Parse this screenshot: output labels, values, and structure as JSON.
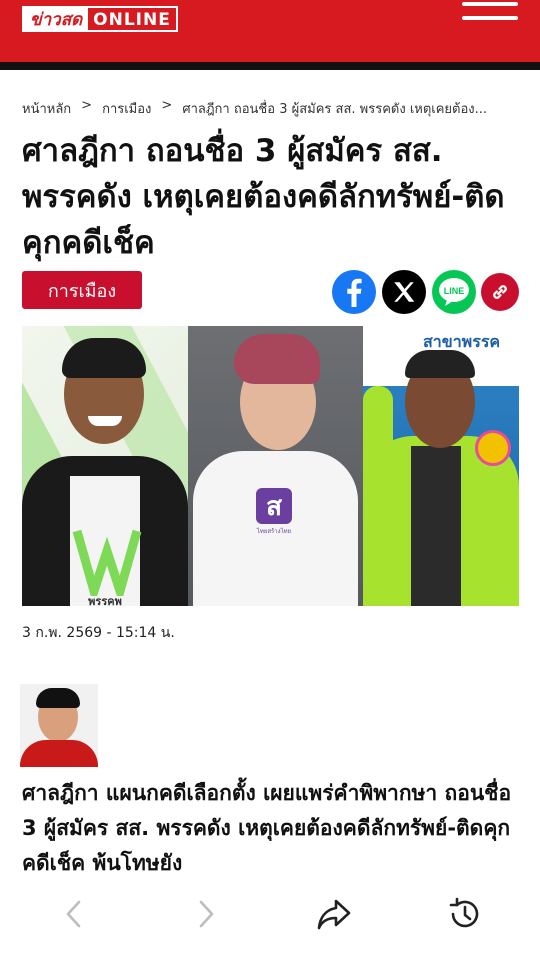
{
  "header": {
    "logo_thai": "ข่าวสด",
    "logo_online": "ONLINE",
    "menu_icon": "hamburger-menu-icon",
    "brand_color": "#d71920"
  },
  "breadcrumb": {
    "home": "หน้าหลัก",
    "section": "การเมือง",
    "current": "ศาลฎีกา ถอนชื่อ 3 ผู้สมัคร สส. พรรคดัง เหตุเคยต้อง...",
    "separator": ">"
  },
  "article": {
    "title": "ศาลฎีกา ถอนชื่อ 3 ผู้สมัคร สส. พรรคดัง เหตุเคยต้องคดีลักทรัพย์-ติดคุกคดีเช็ค",
    "category": "การเมือง",
    "date": "3 ก.พ. 2569 - 15:14 น.",
    "lead": "ศาลฎีกา แผนกคดีเลือกตั้ง เผยแพร่คำพิพากษา ถอนชื่อ 3 ผู้สมัคร สส. พรรคดัง เหตุเคยต้องคดีลักทรัพย์-ติดคุกคดีเช็ค พ้นโทษยัง"
  },
  "share": {
    "facebook": "facebook-icon",
    "x": "x-icon",
    "line": "line-icon",
    "line_text": "LINE",
    "copy_link": "link-icon"
  },
  "photos": {
    "panel1_shirt_text": "พรรคพ",
    "panel2_badge": "ส",
    "panel2_badge_sub": "ไทยสร้างไทย",
    "panel3_banner": "สาขาพรรค"
  },
  "toolbar": {
    "back": "chevron-left-icon",
    "forward": "chevron-right-icon",
    "share": "share-icon",
    "history": "history-icon"
  }
}
